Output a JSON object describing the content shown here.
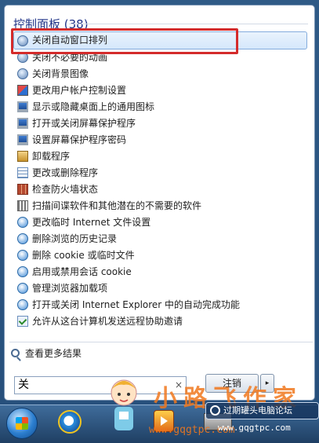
{
  "section": {
    "title": "控制面板 (38)"
  },
  "items": [
    {
      "label": "关闭自动窗口排列",
      "icon": "ease-of-access-icon",
      "selected": true
    },
    {
      "label": "关闭不必要的动画",
      "icon": "ease-of-access-icon"
    },
    {
      "label": "关闭背景图像",
      "icon": "ease-of-access-icon"
    },
    {
      "label": "更改用户帐户控制设置",
      "icon": "uac-flag-icon"
    },
    {
      "label": "显示或隐藏桌面上的通用图标",
      "icon": "monitor-icon"
    },
    {
      "label": "打开或关闭屏幕保护程序",
      "icon": "monitor-icon"
    },
    {
      "label": "设置屏幕保护程序密码",
      "icon": "monitor-icon"
    },
    {
      "label": "卸载程序",
      "icon": "programs-icon"
    },
    {
      "label": "更改或删除程序",
      "icon": "programs-list-icon"
    },
    {
      "label": "检查防火墙状态",
      "icon": "firewall-icon"
    },
    {
      "label": "扫描间谍软件和其他潜在的不需要的软件",
      "icon": "scanner-icon"
    },
    {
      "label": "更改临时 Internet 文件设置",
      "icon": "internet-options-icon"
    },
    {
      "label": "删除浏览的历史记录",
      "icon": "internet-options-icon"
    },
    {
      "label": "删除 cookie 或临时文件",
      "icon": "internet-options-icon"
    },
    {
      "label": "启用或禁用会话 cookie",
      "icon": "internet-options-icon"
    },
    {
      "label": "管理浏览器加载项",
      "icon": "internet-options-icon"
    },
    {
      "label": "打开或关闭 Internet Explorer 中的自动完成功能",
      "icon": "internet-options-icon"
    },
    {
      "label": "允许从这台计算机发送远程协助邀请",
      "icon": "remote-assistance-icon"
    }
  ],
  "more_results": "查看更多结果",
  "search": {
    "value": "关",
    "clear": "×"
  },
  "shutdown": {
    "label": "注销",
    "arrow": "▸"
  },
  "watermark": {
    "text": "小路飞作家",
    "sub": "www.gqgtpc.com",
    "badge": "过期罐头电脑论坛",
    "url": "www.gqgtpc.com"
  },
  "colors": {
    "highlight": "#d42b2b",
    "accent": "#1e3287"
  }
}
